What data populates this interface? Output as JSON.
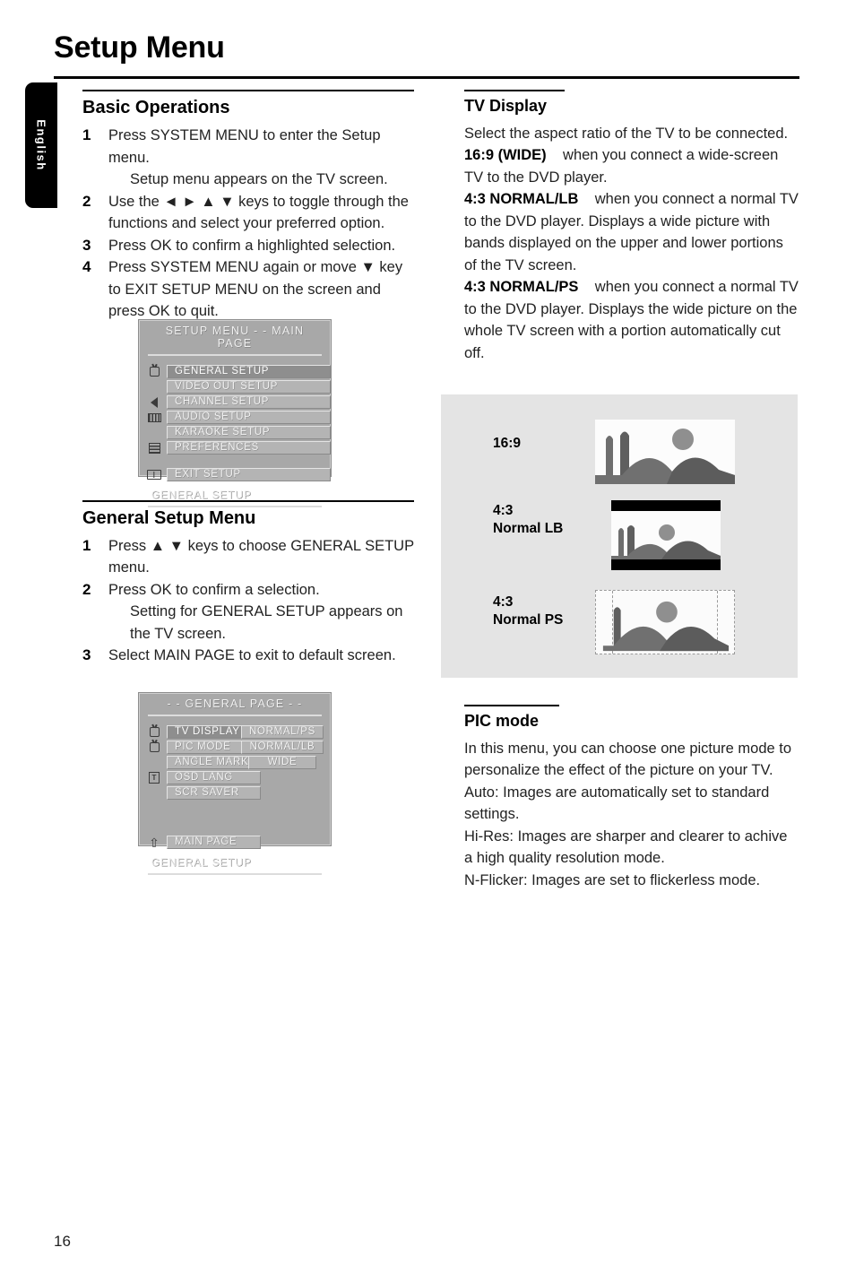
{
  "page": {
    "title": "Setup Menu",
    "number": "16",
    "language_tab": "English"
  },
  "left_column": {
    "basic_operations": {
      "heading": "Basic Operations",
      "steps": [
        {
          "num": "1",
          "text": "Press SYSTEM MENU to enter the Setup menu.",
          "sub": "Setup menu appears on the TV screen."
        },
        {
          "num": "2",
          "text": "Use the ◄ ► ▲ ▼ keys to toggle through the functions and select your preferred option.",
          "sub": ""
        },
        {
          "num": "3",
          "text": "Press OK to confirm a highlighted selection.",
          "sub": ""
        },
        {
          "num": "4",
          "text": "Press SYSTEM MENU again or move ▼ key to EXIT SETUP MENU on the screen and press OK to quit.",
          "sub": ""
        }
      ]
    },
    "general_setup_menu": {
      "heading": "General Setup Menu",
      "steps": [
        {
          "num": "1",
          "text": "Press ▲ ▼ keys to choose GENERAL SETUP menu.",
          "sub": ""
        },
        {
          "num": "2",
          "text": "Press OK to confirm a selection.",
          "sub": "Setting for GENERAL SETUP appears on the TV screen."
        },
        {
          "num": "3",
          "text": "Select MAIN PAGE to exit to default screen.",
          "sub": ""
        }
      ]
    }
  },
  "osd_main_page": {
    "title": "SETUP MENU -  - MAIN PAGE",
    "footer": "GENERAL SETUP",
    "items": [
      {
        "label": "GENERAL SETUP",
        "icon": "tv-icon",
        "highlighted": true
      },
      {
        "label": "VIDEO OUT SETUP",
        "icon": "none",
        "highlighted": false
      },
      {
        "label": "CHANNEL SETUP",
        "icon": "speaker-icon",
        "highlighted": false
      },
      {
        "label": "AUDIO SETUP",
        "icon": "film-icon",
        "highlighted": false
      },
      {
        "label": "KARAOKE SETUP",
        "icon": "none",
        "highlighted": false
      },
      {
        "label": "PREFERENCES",
        "icon": "list-icon",
        "highlighted": false
      }
    ],
    "exit_item": {
      "label": "EXIT SETUP",
      "icon": "screen-icon"
    }
  },
  "osd_general_page": {
    "title": "- -  GENERAL  PAGE  - -",
    "footer": "GENERAL SETUP",
    "items": [
      {
        "label": "TV DISPLAY",
        "icon": "tv-icon",
        "highlighted": true
      },
      {
        "label": "PIC MODE",
        "icon": "tv-icon",
        "highlighted": false
      },
      {
        "label": "ANGLE MARK",
        "icon": "none",
        "highlighted": false
      },
      {
        "label": "OSD LANG",
        "icon": "lang-icon",
        "highlighted": false
      },
      {
        "label": "SCR SAVER",
        "icon": "none",
        "highlighted": false
      }
    ],
    "options": [
      {
        "label": "NORMAL/PS",
        "highlighted": true
      },
      {
        "label": "NORMAL/LB",
        "highlighted": false
      },
      {
        "label": "WIDE",
        "highlighted": false
      }
    ],
    "main_page_item": {
      "label": "MAIN PAGE",
      "icon": "arrow-up-icon"
    }
  },
  "right_column": {
    "tv_display": {
      "heading": "TV Display",
      "intro": "Select the aspect ratio of the TV to be connected.",
      "options": [
        {
          "term": "16:9 (WIDE)",
          "desc": "when you connect a wide-screen TV to the DVD player."
        },
        {
          "term": "4:3 NORMAL/LB",
          "desc": "when you connect a normal TV to the DVD player. Displays a wide picture with bands displayed on the upper and lower portions of the TV screen."
        },
        {
          "term": "4:3 NORMAL/PS",
          "desc": "when you connect a normal TV to the DVD player. Displays the wide picture on the whole TV screen with a portion automatically cut off."
        }
      ]
    },
    "aspect_panel": {
      "rows": [
        {
          "label_line1": "16:9",
          "label_line2": "",
          "style": "wide"
        },
        {
          "label_line1": "4:3",
          "label_line2": "Normal LB",
          "style": "letterbox"
        },
        {
          "label_line1": "4:3",
          "label_line2": "Normal PS",
          "style": "panscan"
        }
      ]
    },
    "pic_mode": {
      "heading": "PIC mode",
      "intro": "In this menu, you can choose one picture mode to personalize the effect of the picture on your TV.",
      "modes": [
        "Auto: Images are automatically set to standard settings.",
        "Hi-Res: Images are sharper and clearer to achive a high quality resolution mode.",
        "N-Flicker: Images are set to flickerless mode."
      ]
    }
  }
}
